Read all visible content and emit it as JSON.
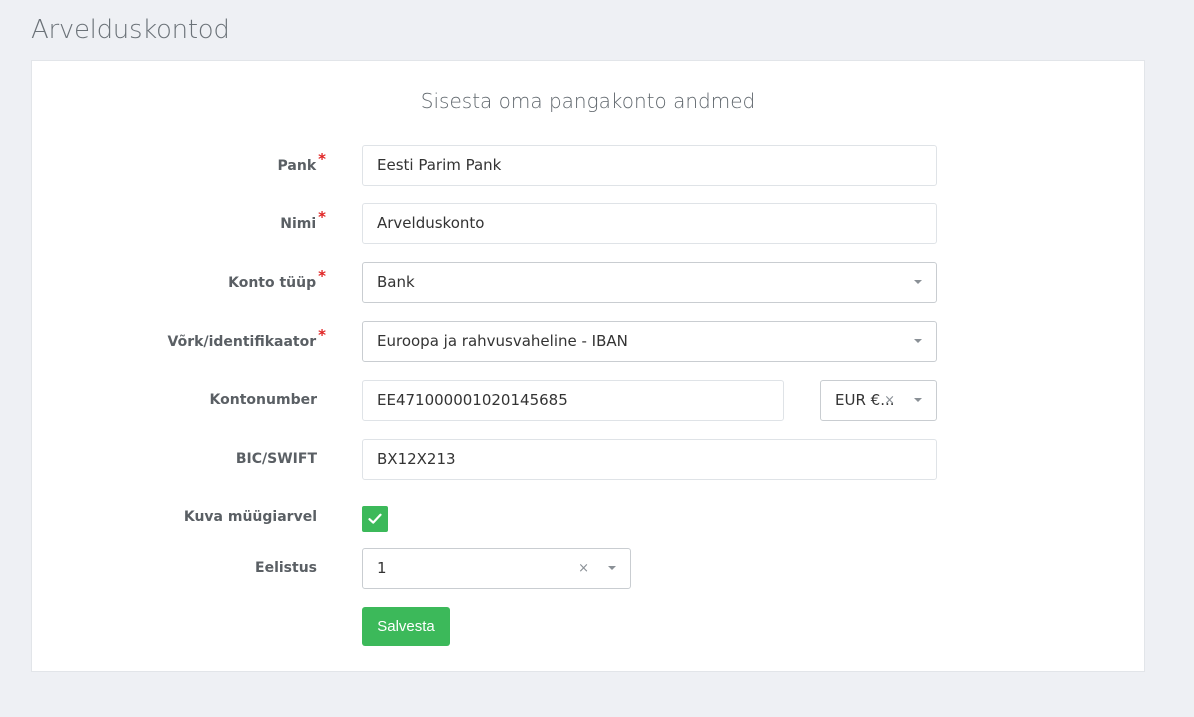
{
  "page": {
    "title": "Arvelduskontod"
  },
  "form": {
    "heading": "Sisesta oma pangakonto andmed",
    "required_mark": "*",
    "bank": {
      "label": "Pank",
      "value": "Eesti Parim Pank"
    },
    "name": {
      "label": "Nimi",
      "value": "Arvelduskonto"
    },
    "account_type": {
      "label": "Konto tüüp",
      "value": "Bank"
    },
    "network": {
      "label": "Võrk/identifikaator",
      "value": "Euroopa ja rahvusvaheline - IBAN"
    },
    "account_number": {
      "label": "Kontonumber",
      "value": "EE471000001020145685"
    },
    "currency": {
      "value": "EUR €...",
      "clear": "×"
    },
    "bic": {
      "label": "BIC/SWIFT",
      "value": "BX12X213"
    },
    "show_on_invoice": {
      "label": "Kuva müügiarvel",
      "checked": true
    },
    "priority": {
      "label": "Eelistus",
      "value": "1",
      "clear": "×"
    },
    "save_label": "Salvesta"
  },
  "colors": {
    "accent": "#3cb95a",
    "required": "#e02424",
    "background": "#eef0f4"
  },
  "icons": {
    "checkbox": "check-icon",
    "dropdown": "chevron-down-icon",
    "clear": "close-icon"
  }
}
